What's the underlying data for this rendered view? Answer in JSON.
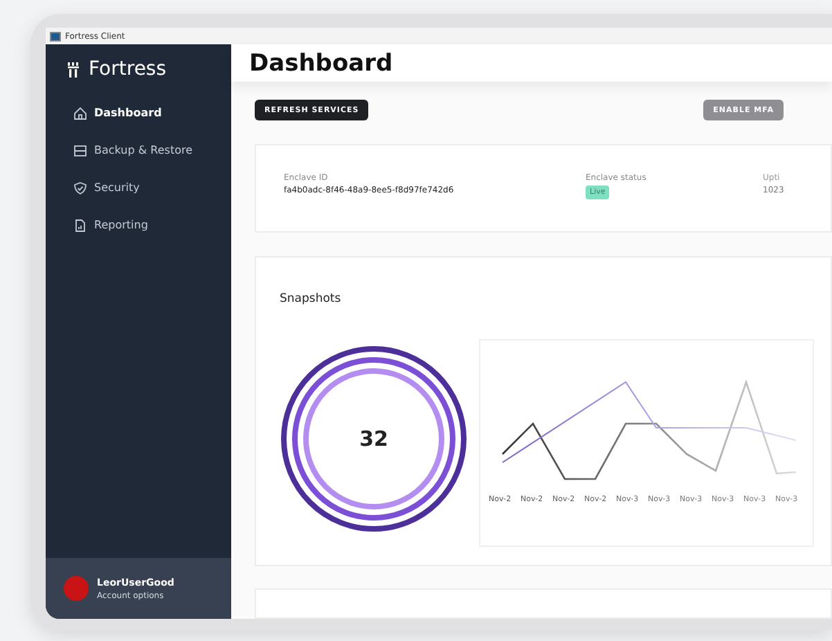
{
  "window": {
    "title": "Fortress Client"
  },
  "sidebar": {
    "brand": "Fortress",
    "items": [
      {
        "label": "Dashboard",
        "selected": true
      },
      {
        "label": "Backup & Restore",
        "selected": false
      },
      {
        "label": "Security",
        "selected": false
      },
      {
        "label": "Reporting",
        "selected": false
      }
    ],
    "account": {
      "name": "LeorUserGood",
      "subtitle": "Account options",
      "color": "#c81414"
    }
  },
  "header": {
    "title": "Dashboard"
  },
  "actions": [
    {
      "label": "REFRESH SERVICES",
      "disabled": false
    },
    {
      "label": "ENABLE MFA",
      "disabled": true
    }
  ],
  "enclave": {
    "fields": [
      {
        "label": "Enclave ID",
        "value": "fa4b0adc-8f46-48a9-8ee5-f8d97fe742d6",
        "kind": "text"
      },
      {
        "label": "Enclave status",
        "value": "Live",
        "kind": "badge"
      },
      {
        "label": "Upti",
        "value": "1023",
        "kind": "text"
      }
    ]
  },
  "snapshots": {
    "title": "Snapshots",
    "count": "32",
    "chart_labels": [
      "Nov-2",
      "Nov-2",
      "Nov-2",
      "Nov-2",
      "Nov-3",
      "Nov-3",
      "Nov-3",
      "Nov-3",
      "Nov-3",
      "Nov-3"
    ]
  }
}
